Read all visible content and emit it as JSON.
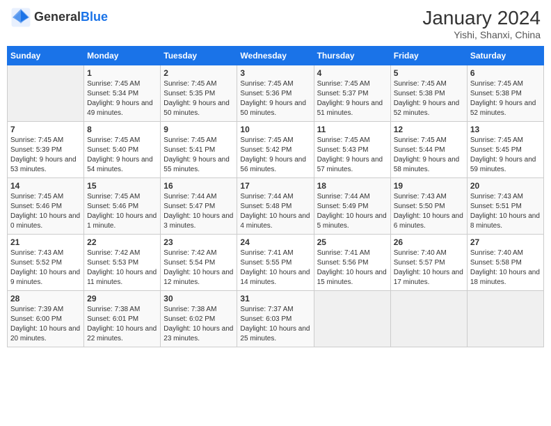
{
  "header": {
    "logo_general": "General",
    "logo_blue": "Blue",
    "month_year": "January 2024",
    "location": "Yishi, Shanxi, China"
  },
  "days_of_week": [
    "Sunday",
    "Monday",
    "Tuesday",
    "Wednesday",
    "Thursday",
    "Friday",
    "Saturday"
  ],
  "weeks": [
    [
      {
        "day": "",
        "sunrise": "",
        "sunset": "",
        "daylight": ""
      },
      {
        "day": "1",
        "sunrise": "Sunrise: 7:45 AM",
        "sunset": "Sunset: 5:34 PM",
        "daylight": "Daylight: 9 hours and 49 minutes."
      },
      {
        "day": "2",
        "sunrise": "Sunrise: 7:45 AM",
        "sunset": "Sunset: 5:35 PM",
        "daylight": "Daylight: 9 hours and 50 minutes."
      },
      {
        "day": "3",
        "sunrise": "Sunrise: 7:45 AM",
        "sunset": "Sunset: 5:36 PM",
        "daylight": "Daylight: 9 hours and 50 minutes."
      },
      {
        "day": "4",
        "sunrise": "Sunrise: 7:45 AM",
        "sunset": "Sunset: 5:37 PM",
        "daylight": "Daylight: 9 hours and 51 minutes."
      },
      {
        "day": "5",
        "sunrise": "Sunrise: 7:45 AM",
        "sunset": "Sunset: 5:38 PM",
        "daylight": "Daylight: 9 hours and 52 minutes."
      },
      {
        "day": "6",
        "sunrise": "Sunrise: 7:45 AM",
        "sunset": "Sunset: 5:38 PM",
        "daylight": "Daylight: 9 hours and 52 minutes."
      }
    ],
    [
      {
        "day": "7",
        "sunrise": "Sunrise: 7:45 AM",
        "sunset": "Sunset: 5:39 PM",
        "daylight": "Daylight: 9 hours and 53 minutes."
      },
      {
        "day": "8",
        "sunrise": "Sunrise: 7:45 AM",
        "sunset": "Sunset: 5:40 PM",
        "daylight": "Daylight: 9 hours and 54 minutes."
      },
      {
        "day": "9",
        "sunrise": "Sunrise: 7:45 AM",
        "sunset": "Sunset: 5:41 PM",
        "daylight": "Daylight: 9 hours and 55 minutes."
      },
      {
        "day": "10",
        "sunrise": "Sunrise: 7:45 AM",
        "sunset": "Sunset: 5:42 PM",
        "daylight": "Daylight: 9 hours and 56 minutes."
      },
      {
        "day": "11",
        "sunrise": "Sunrise: 7:45 AM",
        "sunset": "Sunset: 5:43 PM",
        "daylight": "Daylight: 9 hours and 57 minutes."
      },
      {
        "day": "12",
        "sunrise": "Sunrise: 7:45 AM",
        "sunset": "Sunset: 5:44 PM",
        "daylight": "Daylight: 9 hours and 58 minutes."
      },
      {
        "day": "13",
        "sunrise": "Sunrise: 7:45 AM",
        "sunset": "Sunset: 5:45 PM",
        "daylight": "Daylight: 9 hours and 59 minutes."
      }
    ],
    [
      {
        "day": "14",
        "sunrise": "Sunrise: 7:45 AM",
        "sunset": "Sunset: 5:46 PM",
        "daylight": "Daylight: 10 hours and 0 minutes."
      },
      {
        "day": "15",
        "sunrise": "Sunrise: 7:45 AM",
        "sunset": "Sunset: 5:46 PM",
        "daylight": "Daylight: 10 hours and 1 minute."
      },
      {
        "day": "16",
        "sunrise": "Sunrise: 7:44 AM",
        "sunset": "Sunset: 5:47 PM",
        "daylight": "Daylight: 10 hours and 3 minutes."
      },
      {
        "day": "17",
        "sunrise": "Sunrise: 7:44 AM",
        "sunset": "Sunset: 5:48 PM",
        "daylight": "Daylight: 10 hours and 4 minutes."
      },
      {
        "day": "18",
        "sunrise": "Sunrise: 7:44 AM",
        "sunset": "Sunset: 5:49 PM",
        "daylight": "Daylight: 10 hours and 5 minutes."
      },
      {
        "day": "19",
        "sunrise": "Sunrise: 7:43 AM",
        "sunset": "Sunset: 5:50 PM",
        "daylight": "Daylight: 10 hours and 6 minutes."
      },
      {
        "day": "20",
        "sunrise": "Sunrise: 7:43 AM",
        "sunset": "Sunset: 5:51 PM",
        "daylight": "Daylight: 10 hours and 8 minutes."
      }
    ],
    [
      {
        "day": "21",
        "sunrise": "Sunrise: 7:43 AM",
        "sunset": "Sunset: 5:52 PM",
        "daylight": "Daylight: 10 hours and 9 minutes."
      },
      {
        "day": "22",
        "sunrise": "Sunrise: 7:42 AM",
        "sunset": "Sunset: 5:53 PM",
        "daylight": "Daylight: 10 hours and 11 minutes."
      },
      {
        "day": "23",
        "sunrise": "Sunrise: 7:42 AM",
        "sunset": "Sunset: 5:54 PM",
        "daylight": "Daylight: 10 hours and 12 minutes."
      },
      {
        "day": "24",
        "sunrise": "Sunrise: 7:41 AM",
        "sunset": "Sunset: 5:55 PM",
        "daylight": "Daylight: 10 hours and 14 minutes."
      },
      {
        "day": "25",
        "sunrise": "Sunrise: 7:41 AM",
        "sunset": "Sunset: 5:56 PM",
        "daylight": "Daylight: 10 hours and 15 minutes."
      },
      {
        "day": "26",
        "sunrise": "Sunrise: 7:40 AM",
        "sunset": "Sunset: 5:57 PM",
        "daylight": "Daylight: 10 hours and 17 minutes."
      },
      {
        "day": "27",
        "sunrise": "Sunrise: 7:40 AM",
        "sunset": "Sunset: 5:58 PM",
        "daylight": "Daylight: 10 hours and 18 minutes."
      }
    ],
    [
      {
        "day": "28",
        "sunrise": "Sunrise: 7:39 AM",
        "sunset": "Sunset: 6:00 PM",
        "daylight": "Daylight: 10 hours and 20 minutes."
      },
      {
        "day": "29",
        "sunrise": "Sunrise: 7:38 AM",
        "sunset": "Sunset: 6:01 PM",
        "daylight": "Daylight: 10 hours and 22 minutes."
      },
      {
        "day": "30",
        "sunrise": "Sunrise: 7:38 AM",
        "sunset": "Sunset: 6:02 PM",
        "daylight": "Daylight: 10 hours and 23 minutes."
      },
      {
        "day": "31",
        "sunrise": "Sunrise: 7:37 AM",
        "sunset": "Sunset: 6:03 PM",
        "daylight": "Daylight: 10 hours and 25 minutes."
      },
      {
        "day": "",
        "sunrise": "",
        "sunset": "",
        "daylight": ""
      },
      {
        "day": "",
        "sunrise": "",
        "sunset": "",
        "daylight": ""
      },
      {
        "day": "",
        "sunrise": "",
        "sunset": "",
        "daylight": ""
      }
    ]
  ]
}
